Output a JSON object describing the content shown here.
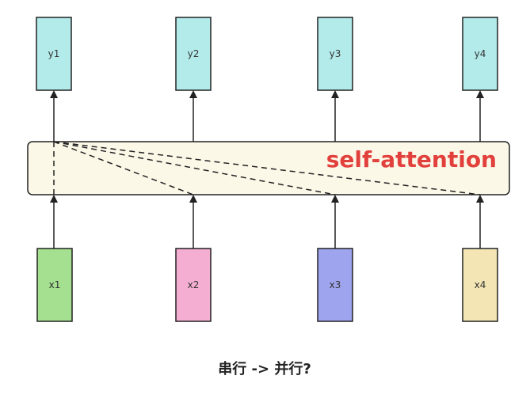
{
  "diagram": {
    "inputs": [
      {
        "id": "x1",
        "label": "x1",
        "fill": "#a4e08f"
      },
      {
        "id": "x2",
        "label": "x2",
        "fill": "#f4aed1"
      },
      {
        "id": "x3",
        "label": "x3",
        "fill": "#9ea5ee"
      },
      {
        "id": "x4",
        "label": "x4",
        "fill": "#f3e6b4"
      }
    ],
    "outputs": [
      {
        "id": "y1",
        "label": "y1",
        "fill": "#b3ebeb"
      },
      {
        "id": "y2",
        "label": "y2",
        "fill": "#b3ebeb"
      },
      {
        "id": "y3",
        "label": "y3",
        "fill": "#b3ebeb"
      },
      {
        "id": "y4",
        "label": "y4",
        "fill": "#b3ebeb"
      }
    ],
    "attention_layer": {
      "label": "self-attention",
      "fill": "#fcf8e8",
      "label_color": "#e2403c"
    },
    "caption": "串行 -> 并行?"
  }
}
